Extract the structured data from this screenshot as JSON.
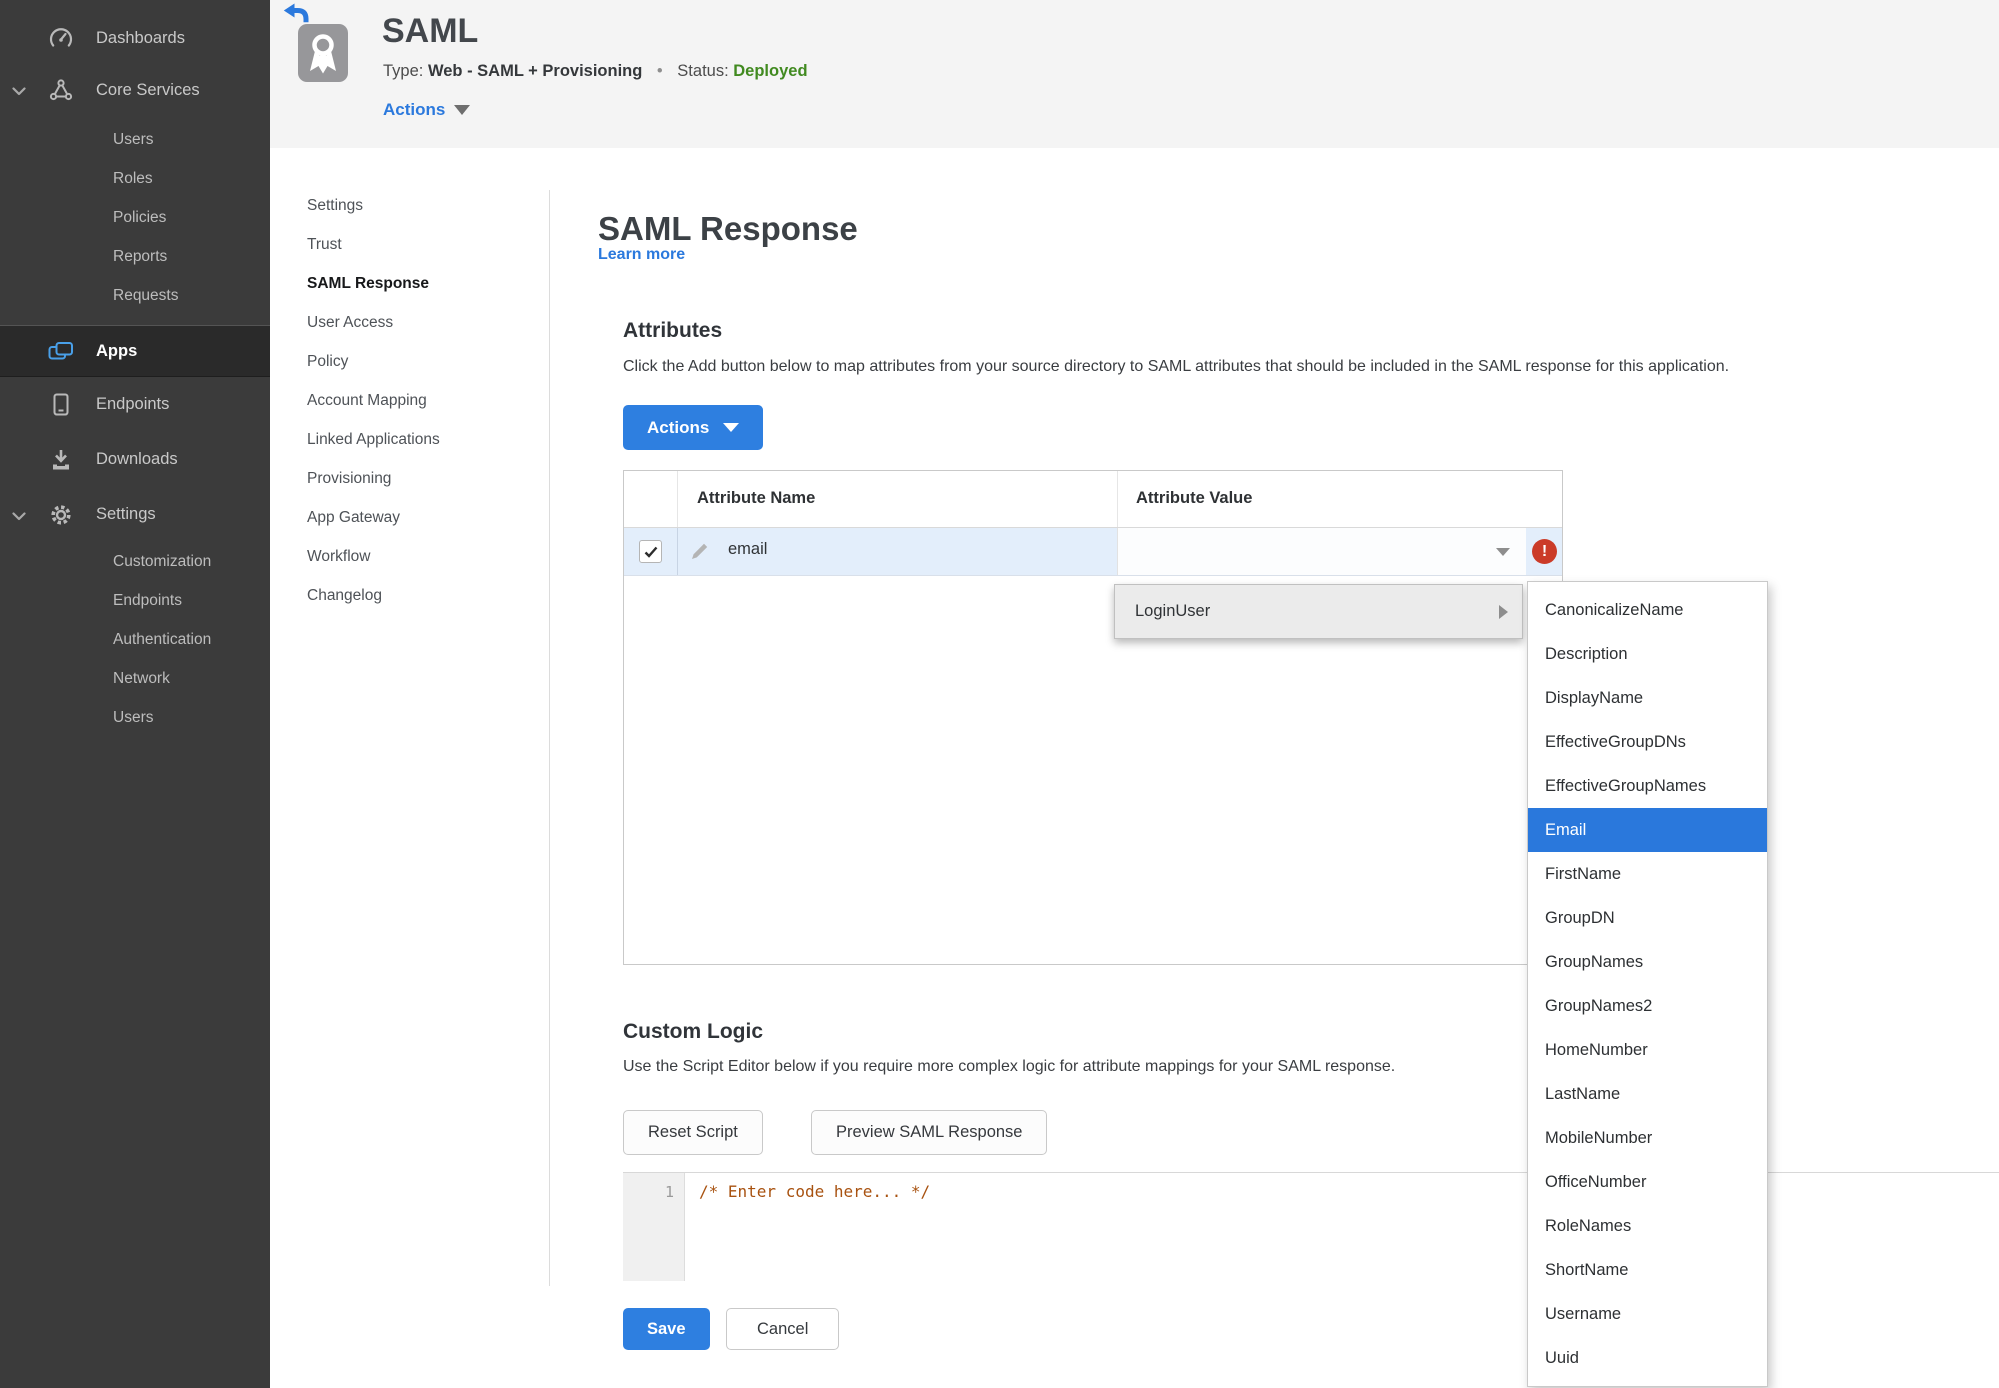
{
  "colors": {
    "accent_blue": "#2b79dd",
    "button_blue": "#2e7fe0",
    "status_green": "#418a20",
    "error_red": "#cb3b28",
    "selected_blue": "#2a78dc",
    "row_highlight": "#e3eefb",
    "sidebar_bg": "#3b3b3b",
    "header_bg": "#f4f4f4",
    "code_comment": "#a85210"
  },
  "sidebar": {
    "dashboards": "Dashboards",
    "core_services": "Core Services",
    "core_children": [
      "Users",
      "Roles",
      "Policies",
      "Reports",
      "Requests"
    ],
    "apps": "Apps",
    "endpoints": "Endpoints",
    "downloads": "Downloads",
    "settings": "Settings",
    "settings_children": [
      "Customization",
      "Endpoints",
      "Authentication",
      "Network",
      "Users"
    ]
  },
  "header": {
    "app_title": "SAML",
    "type_label": "Type:",
    "type_value": "Web - SAML + Provisioning",
    "separator": "•",
    "status_label": "Status:",
    "status_value": "Deployed",
    "actions_label": "Actions"
  },
  "subnav": {
    "items": [
      {
        "label": "Settings",
        "cls": ""
      },
      {
        "label": "Trust",
        "cls": ""
      },
      {
        "label": "SAML Response",
        "cls": "active"
      },
      {
        "label": "User Access",
        "cls": ""
      },
      {
        "label": "Policy",
        "cls": ""
      },
      {
        "label": "Account Mapping",
        "cls": ""
      },
      {
        "label": "Linked Applications",
        "cls": ""
      },
      {
        "label": "Provisioning",
        "cls": ""
      },
      {
        "label": "App Gateway",
        "cls": ""
      },
      {
        "label": "Workflow",
        "cls": ""
      },
      {
        "label": "Changelog",
        "cls": ""
      }
    ]
  },
  "main": {
    "title": "SAML Response",
    "learn_more": "Learn more",
    "attributes": {
      "heading": "Attributes",
      "description": "Click the Add button below to map attributes from your source directory to SAML attributes that should be included in the SAML response for this application.",
      "actions_button": "Actions",
      "table": {
        "col_name": "Attribute Name",
        "col_value": "Attribute Value",
        "row_name": "email",
        "row_value": "",
        "error_glyph": "!"
      }
    },
    "dropdown": {
      "item": "LoginUser",
      "submenu": [
        {
          "label": "CanonicalizeName",
          "cls": ""
        },
        {
          "label": "Description",
          "cls": ""
        },
        {
          "label": "DisplayName",
          "cls": ""
        },
        {
          "label": "EffectiveGroupDNs",
          "cls": ""
        },
        {
          "label": "EffectiveGroupNames",
          "cls": ""
        },
        {
          "label": "Email",
          "cls": "selected"
        },
        {
          "label": "FirstName",
          "cls": ""
        },
        {
          "label": "GroupDN",
          "cls": ""
        },
        {
          "label": "GroupNames",
          "cls": ""
        },
        {
          "label": "GroupNames2",
          "cls": ""
        },
        {
          "label": "HomeNumber",
          "cls": ""
        },
        {
          "label": "LastName",
          "cls": ""
        },
        {
          "label": "MobileNumber",
          "cls": ""
        },
        {
          "label": "OfficeNumber",
          "cls": ""
        },
        {
          "label": "RoleNames",
          "cls": ""
        },
        {
          "label": "ShortName",
          "cls": ""
        },
        {
          "label": "Username",
          "cls": ""
        },
        {
          "label": "Uuid",
          "cls": ""
        }
      ]
    },
    "custom_logic": {
      "heading": "Custom Logic",
      "description": "Use the Script Editor below if you require more complex logic for attribute mappings for your SAML response.",
      "reset_button": "Reset Script",
      "preview_button": "Preview SAML Response",
      "editor": {
        "line_number": "1",
        "code": "/* Enter code here... */"
      }
    },
    "footer": {
      "save": "Save",
      "cancel": "Cancel"
    }
  }
}
